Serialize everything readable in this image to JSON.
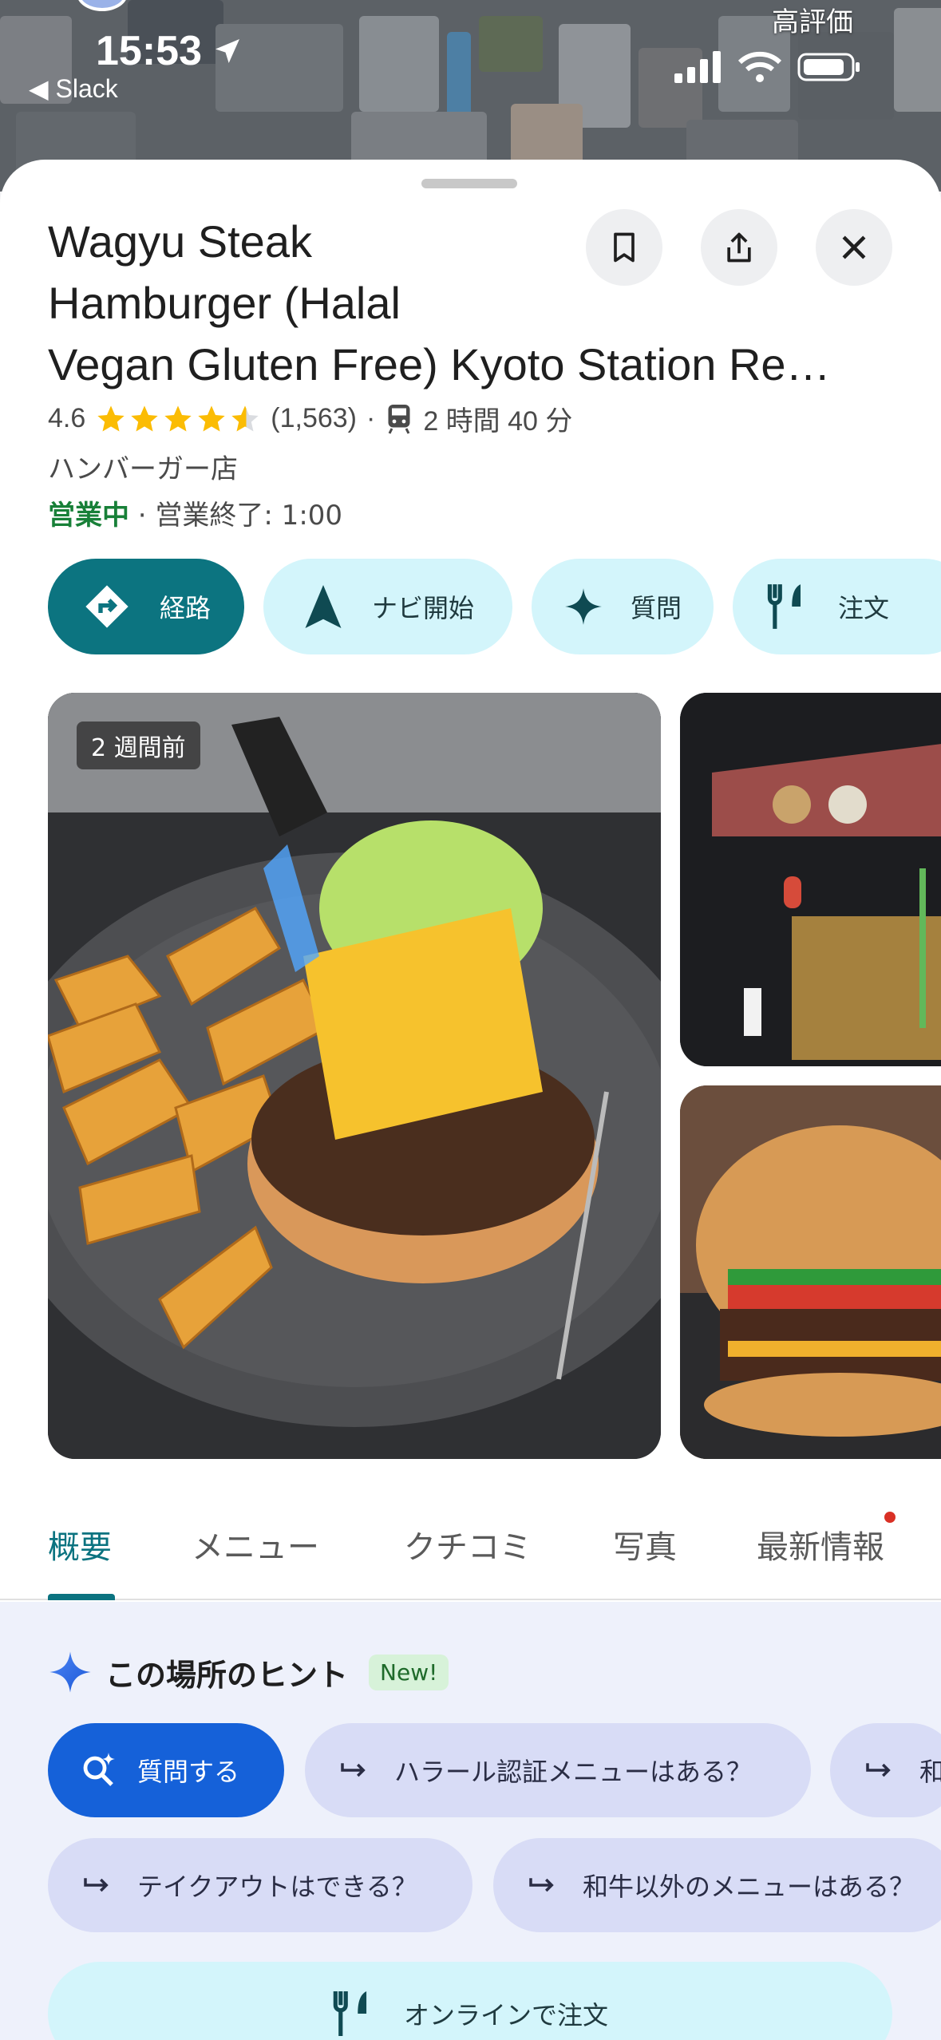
{
  "status_bar": {
    "time": "15:53",
    "back_app": "◀ Slack"
  },
  "map": {
    "label": "高評価"
  },
  "place": {
    "title_line1": "Wagyu Steak",
    "title_line2": "Hamburger (Halal",
    "title_line3": "Vegan Gluten Free) Kyoto Station Re…",
    "rating": "4.6",
    "stars_value": 4.6,
    "review_count": "(1,563)",
    "separator": "·",
    "transit_time": "2 時間 40 分",
    "category": "ハンバーガー店",
    "open_status": "営業中",
    "hours_text": " · 営業終了: 1:00"
  },
  "actions": [
    {
      "label": "経路",
      "icon": "directions-icon"
    },
    {
      "label": "ナビ開始",
      "icon": "navigation-arrow-icon"
    },
    {
      "label": "質問",
      "icon": "sparkle-icon"
    },
    {
      "label": "注文",
      "icon": "fork-knife-icon"
    }
  ],
  "photos": {
    "main_badge": "2 週間前"
  },
  "tabs": [
    {
      "label": "概要"
    },
    {
      "label": "メニュー"
    },
    {
      "label": "クチコミ"
    },
    {
      "label": "写真"
    },
    {
      "label": "最新情報"
    }
  ],
  "hints": {
    "title": "この場所のヒント",
    "new_badge": "New!",
    "ask_label": "質問する",
    "suggestions": [
      "ハラール認証メニューはある？",
      "和",
      "テイクアウトはできる？",
      "和牛以外のメニューはある？"
    ]
  },
  "order": {
    "label": "オンラインで注文"
  },
  "colors": {
    "primary_teal": "#0c7480",
    "chip_bg": "#d3f5fb",
    "open_green": "#188038",
    "star_yellow": "#fbbc04",
    "ask_blue": "#1561d9"
  }
}
